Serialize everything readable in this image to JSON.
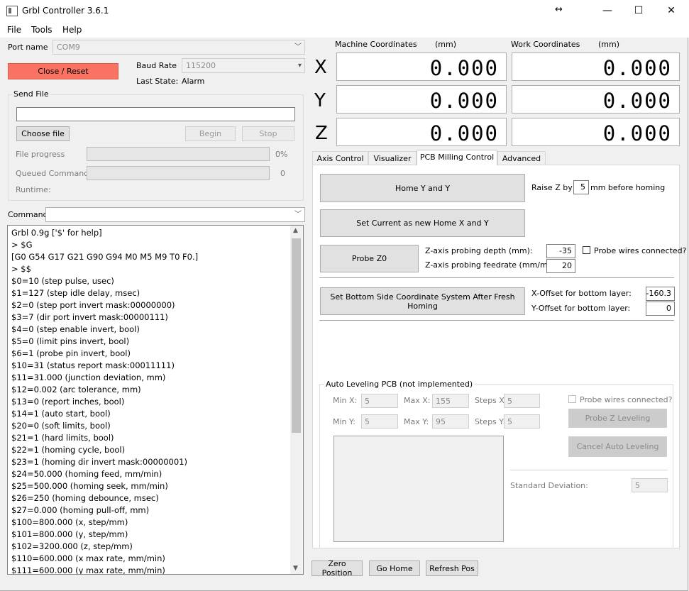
{
  "window": {
    "title": "Grbl Controller 3.6.1"
  },
  "menu": {
    "file": "File",
    "tools": "Tools",
    "help": "Help"
  },
  "connection": {
    "port_label": "Port name",
    "port_value": "COM9",
    "close_reset": "Close / Reset",
    "baud_label": "Baud Rate",
    "baud_value": "115200",
    "last_state_label": "Last State:",
    "last_state_value": "Alarm"
  },
  "send_file": {
    "title": "Send File",
    "choose_file": "Choose file",
    "begin": "Begin",
    "stop": "Stop",
    "file_progress_label": "File progress",
    "file_progress_value": "0%",
    "file_progress_pct": 0,
    "queued_label": "Queued Commands",
    "queued_value": "0",
    "runtime_label": "Runtime:"
  },
  "command": {
    "label": "Command"
  },
  "console": {
    "lines": [
      "Grbl 0.9g ['$' for help]",
      "> $G",
      "[G0 G54 G17 G21 G90 G94 M0 M5 M9 T0 F0.]",
      "> $$",
      "$0=10 (step pulse, usec)",
      "$1=127 (step idle delay, msec)",
      "$2=0 (step port invert mask:00000000)",
      "$3=7 (dir port invert mask:00000111)",
      "$4=0 (step enable invert, bool)",
      "$5=0 (limit pins invert, bool)",
      "$6=1 (probe pin invert, bool)",
      "$10=31 (status report mask:00011111)",
      "$11=31.000 (junction deviation, mm)",
      "$12=0.002 (arc tolerance, mm)",
      "$13=0 (report inches, bool)",
      "$14=1 (auto start, bool)",
      "$20=0 (soft limits, bool)",
      "$21=1 (hard limits, bool)",
      "$22=1 (homing cycle, bool)",
      "$23=1 (homing dir invert mask:00000001)",
      "$24=50.000 (homing feed, mm/min)",
      "$25=500.000 (homing seek, mm/min)",
      "$26=250 (homing debounce, msec)",
      "$27=0.000 (homing pull-off, mm)",
      "$100=800.000 (x, step/mm)",
      "$101=800.000 (y, step/mm)",
      "$102=3200.000 (z, step/mm)",
      "$110=600.000 (x max rate, mm/min)",
      "$111=600.000 (y max rate, mm/min)"
    ]
  },
  "coords": {
    "machine_label": "Machine Coordinates",
    "work_label": "Work Coordinates",
    "unit": "(mm)",
    "axes": [
      {
        "axis": "X",
        "machine": "0.000",
        "work": "0.000"
      },
      {
        "axis": "Y",
        "machine": "0.000",
        "work": "0.000"
      },
      {
        "axis": "Z",
        "machine": "0.000",
        "work": "0.000"
      }
    ]
  },
  "tabs": [
    {
      "label": "Axis Control"
    },
    {
      "label": "Visualizer"
    },
    {
      "label": "PCB Milling Control"
    },
    {
      "label": "Advanced"
    }
  ],
  "pcb": {
    "home_xy": "Home Y and Y",
    "raise_z_label": "Raise Z by",
    "raise_z_value": "5",
    "raise_z_suffix": "mm before homing",
    "set_home": "Set Current as new Home X and Y",
    "probe_z0": "Probe Z0",
    "probe_depth_label": "Z-axis probing depth (mm):",
    "probe_depth_value": "-35",
    "probe_feed_label": "Z-axis probing feedrate (mm/min):",
    "probe_feed_value": "20",
    "probe_wires_label": "Probe wires connected?",
    "bottom_side": "Set Bottom Side Coordinate System After Fresh Homing",
    "x_offset_label": "X-Offset for bottom layer:",
    "x_offset_value": "-160.3",
    "y_offset_label": "Y-Offset for bottom layer:",
    "y_offset_value": "0"
  },
  "autolevel": {
    "title": "Auto Leveling PCB (not implemented)",
    "min_x_label": "Min X:",
    "min_x": "5",
    "max_x_label": "Max X:",
    "max_x": "155",
    "steps_x_label": "Steps X:",
    "steps_x": "5",
    "min_y_label": "Min Y:",
    "min_y": "5",
    "max_y_label": "Max Y:",
    "max_y": "95",
    "steps_y_label": "Steps Y:",
    "steps_y": "5",
    "probe_wires_label": "Probe wires connected?",
    "probe_z_leveling": "Probe Z Leveling",
    "cancel_leveling": "Cancel Auto Leveling",
    "std_dev_label": "Standard Deviation:",
    "std_dev_value": "5"
  },
  "bottom": {
    "zero_position": "Zero Position",
    "go_home": "Go Home",
    "refresh_pos": "Refresh Pos"
  }
}
